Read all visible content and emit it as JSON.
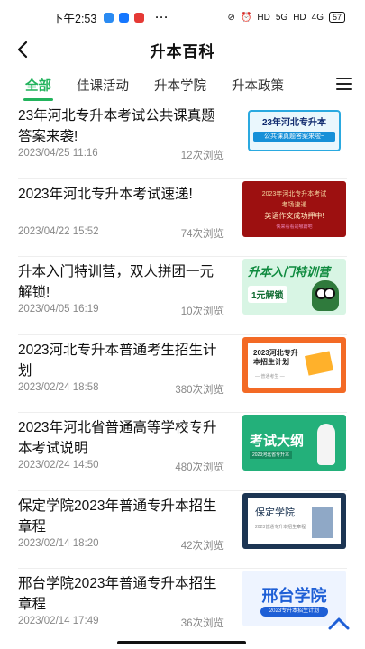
{
  "statusbar": {
    "time": "下午2:53",
    "network_5g": "5G",
    "network_4g": "4G",
    "hd1": "HD",
    "hd2": "HD",
    "battery": "57"
  },
  "header": {
    "title": "升本百科"
  },
  "tabs": [
    {
      "label": "全部",
      "active": true
    },
    {
      "label": "佳课活动",
      "active": false
    },
    {
      "label": "升本学院",
      "active": false
    },
    {
      "label": "升本政策",
      "active": false
    }
  ],
  "articles": [
    {
      "title": "23年河北专升本考试公共课真题答案来袭!",
      "date": "2023/04/25 11:16",
      "views": "12次浏览",
      "thumb": {
        "a": "23年河北专升本",
        "b": "公共课真题答案来啦~"
      }
    },
    {
      "title": "2023年河北专升本考试速递!",
      "date": "2023/04/22 15:52",
      "views": "74次浏览",
      "thumb": {
        "a": "2023年河北专升本考试",
        "b": "考场速递",
        "c": "英语作文成功押中!",
        "d": "快来看看是哪篇吧"
      }
    },
    {
      "title": "升本入门特训营，双人拼团一元解锁!",
      "date": "2023/04/05 16:19",
      "views": "10次浏览",
      "thumb": {
        "a": "升本入门特训营",
        "b": "1元解锁"
      }
    },
    {
      "title": "2023河北专升本普通考生招生计划",
      "date": "2023/02/24 18:58",
      "views": "380次浏览",
      "thumb": {
        "a": "2023河北专升本招生计划",
        "b": "— 普通考生 —"
      }
    },
    {
      "title": "2023年河北省普通高等学校专升本考试说明",
      "date": "2023/02/24 14:50",
      "views": "480次浏览",
      "thumb": {
        "a": "考试大纲",
        "b": "2023河北省专升本"
      }
    },
    {
      "title": "保定学院2023年普通专升本招生章程",
      "date": "2023/02/14 18:20",
      "views": "42次浏览",
      "thumb": {
        "a": "保定学院",
        "b": "2023普通专升本招生章程"
      }
    },
    {
      "title": "邢台学院2023年普通专升本招生章程",
      "date": "2023/02/14 17:49",
      "views": "36次浏览",
      "thumb": {
        "a": "邢台学院",
        "b": "2023专升本招生计划"
      }
    }
  ],
  "icons": {
    "back": "back-arrow-icon",
    "menu": "hamburger-menu-icon",
    "totop": "chevron-up-icon"
  },
  "colors": {
    "accent": "#22b35c"
  }
}
